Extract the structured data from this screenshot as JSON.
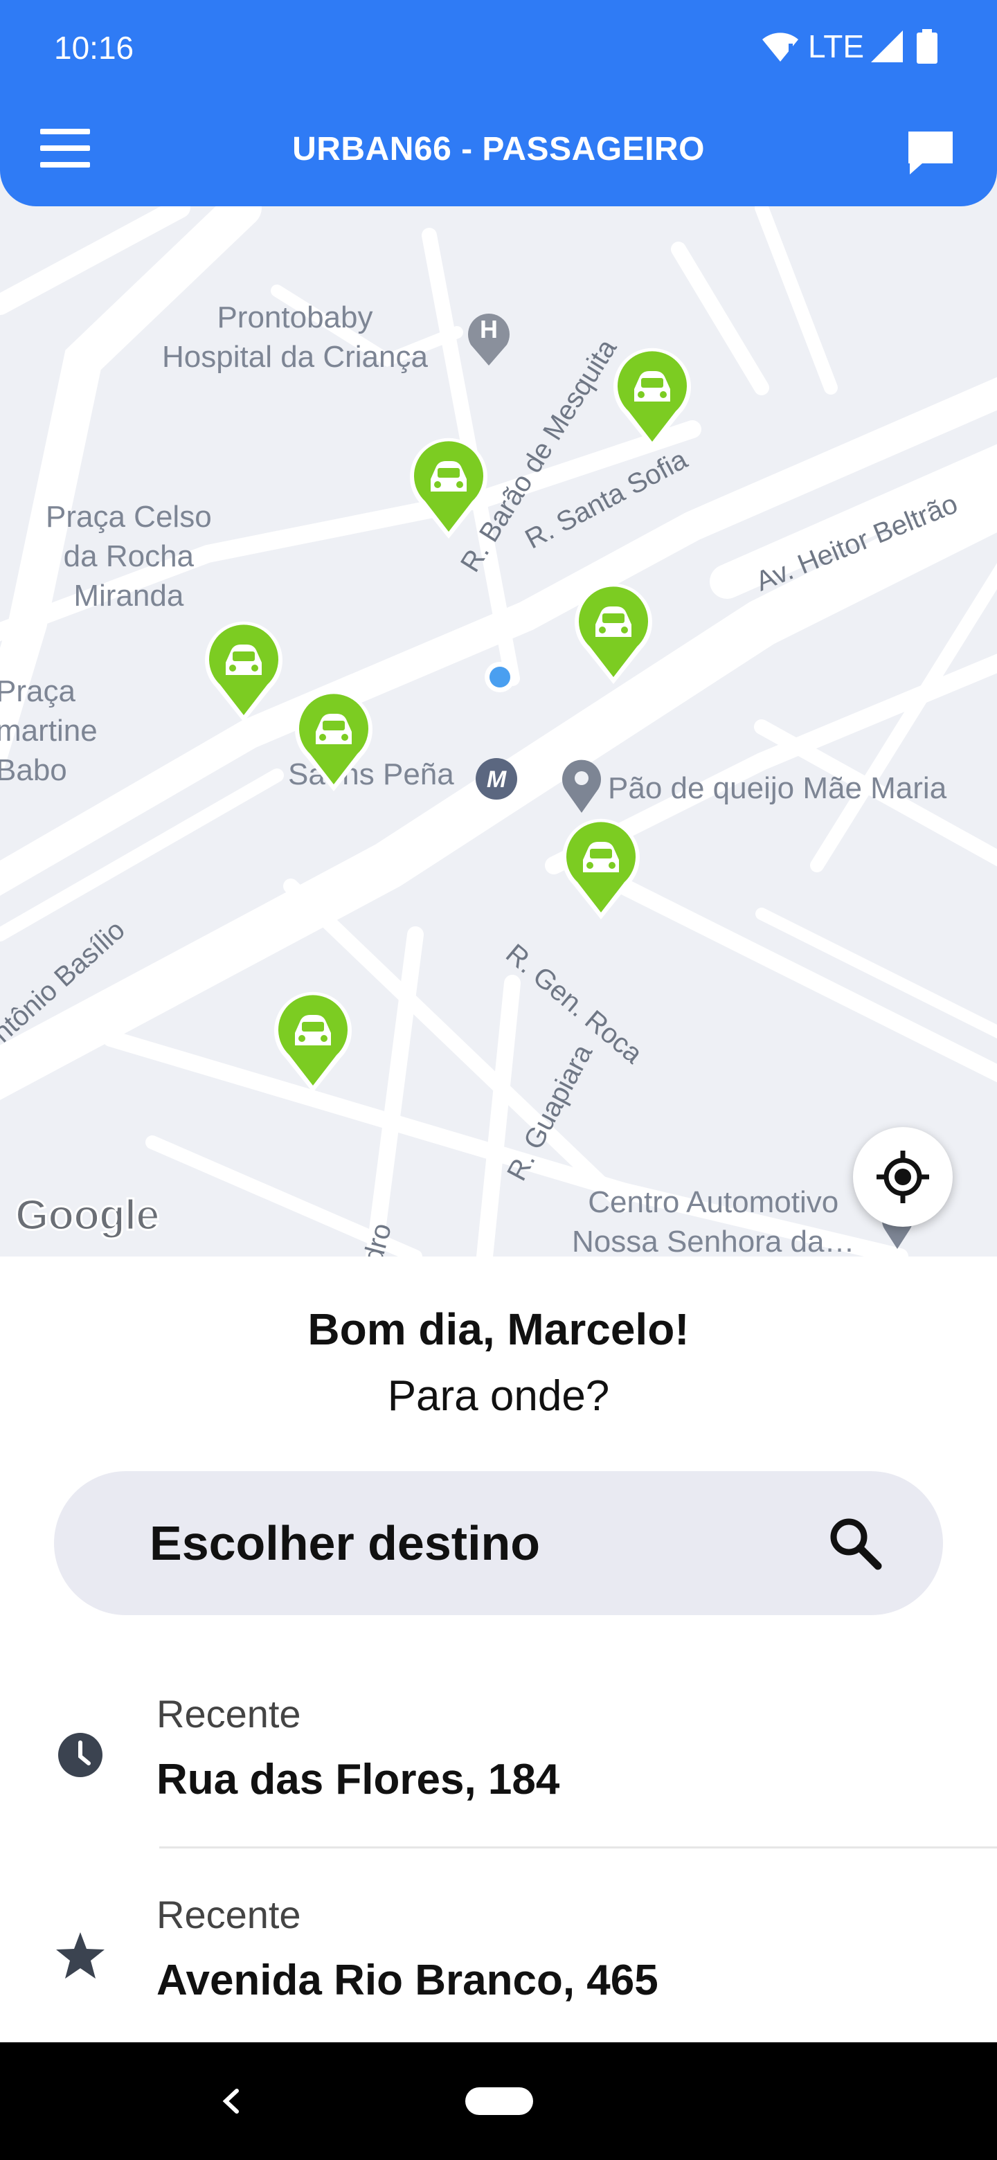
{
  "status_bar": {
    "time": "10:16",
    "network": "LTE"
  },
  "header": {
    "title": "URBAN66 - PASSAGEIRO",
    "menu_icon": "hamburger-menu-icon",
    "chat_icon": "chat-bubble-icon"
  },
  "map": {
    "places": {
      "prontobaby": "Prontobaby\nHospital da Criança",
      "praca_celso": "Praça Celso\nda Rocha\nMiranda",
      "praca_lamartine": "Praça\nmartine\nBabo",
      "saens_pena": "Saens Peña",
      "pao_de_queijo": "Pão de queijo Mãe Maria",
      "centro_automotivo": "Centro Automotivo\nNossa Senhora da…"
    },
    "streets": {
      "barao_mesquita": "R. Barão de Mesquita",
      "santa_sofia": "R. Santa Sofia",
      "heitor_beltrao": "Av. Heitor Beltrão",
      "antonio_basilio": "ntônio Basílio",
      "gen_roca": "R. Gen. Roca",
      "guapiara": "R. Guapiara",
      "idro": "idro"
    },
    "attribution": "Google",
    "car_count": 7
  },
  "panel": {
    "greeting": "Bom dia, Marcelo!",
    "prompt": "Para onde?",
    "search_label": "Escolher destino",
    "recent": [
      {
        "label": "Recente",
        "address": "Rua das Flores, 184",
        "icon": "clock-icon"
      },
      {
        "label": "Recente",
        "address": "Avenida Rio Branco, 465",
        "icon": "star-icon"
      }
    ]
  },
  "colors": {
    "primary": "#2f7bf5",
    "car_pin": "#7ccc22",
    "map_bg": "#eef0f5",
    "road": "#ffffff"
  }
}
